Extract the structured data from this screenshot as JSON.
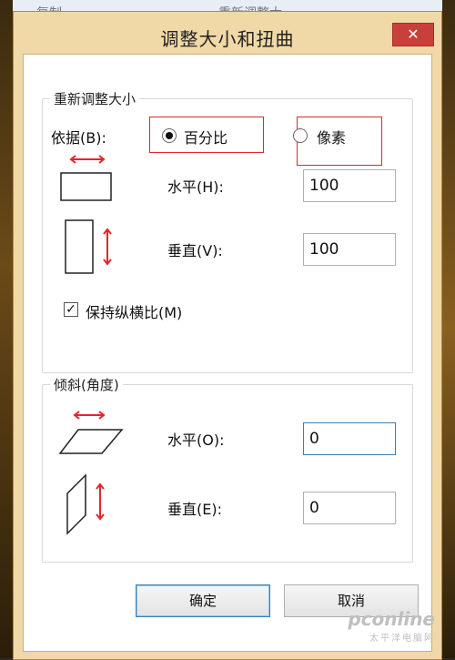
{
  "background": {
    "toolbar_left": "复制",
    "toolbar_right": "重新调整大"
  },
  "dialog": {
    "title": "调整大小和扭曲",
    "close_glyph": "✕",
    "resize": {
      "legend": "重新调整大小",
      "by_label": "依据(B):",
      "option_percent": "百分比",
      "option_pixels": "像素",
      "selected": "百分比",
      "horizontal_label": "水平(H):",
      "horizontal_value": "100",
      "vertical_label": "垂直(V):",
      "vertical_value": "100",
      "keep_ratio_label": "保持纵横比(M)",
      "keep_ratio_checked": true,
      "check_glyph": "✓"
    },
    "skew": {
      "legend": "倾斜(角度)",
      "horizontal_label": "水平(O):",
      "horizontal_value": "0",
      "vertical_label": "垂直(E):",
      "vertical_value": "0"
    },
    "buttons": {
      "ok": "确定",
      "cancel": "取消"
    }
  },
  "watermark": {
    "main": "pconline",
    "sub": "太平洋电脑网"
  },
  "colors": {
    "highlight": "#e0262b",
    "arrow": "#e0262b",
    "close_bg": "#c9403a",
    "frame": "#f0d9a6"
  }
}
